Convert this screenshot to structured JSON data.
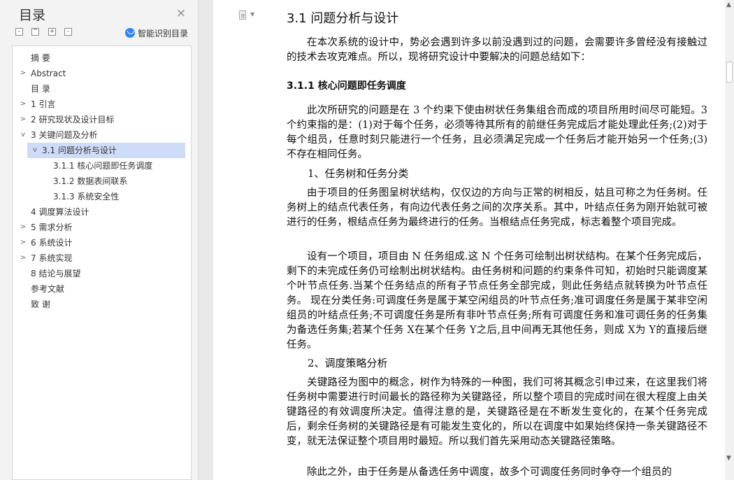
{
  "sidebar": {
    "title": "目录",
    "close_icon": "×",
    "tools": {
      "collapse_all": "-",
      "expand_up": "^",
      "add": "+",
      "remove": "-"
    },
    "smart_toc_label": "智能识别目录",
    "items": [
      {
        "label": "摘  要"
      },
      {
        "label": "Abstract",
        "arrow": ">"
      },
      {
        "label": "目  录"
      },
      {
        "label": "1   引言",
        "arrow": ">"
      },
      {
        "label": "2   研究现状及设计目标",
        "arrow": ">"
      },
      {
        "label": "3   关键问题及分析",
        "arrow": "v"
      },
      {
        "label": "3.1   问题分析与设计",
        "arrow": "v"
      },
      {
        "label": "3.1.1   核心问题即任务调度"
      },
      {
        "label": "3.1.2   数据表间联系"
      },
      {
        "label": "3.1.3   系统安全性"
      },
      {
        "label": "4   调度算法设计"
      },
      {
        "label": "5   需求分析",
        "arrow": ">"
      },
      {
        "label": "6   系统设计",
        "arrow": ">"
      },
      {
        "label": "7   系统实现",
        "arrow": ">"
      },
      {
        "label": "8   结论与展望"
      },
      {
        "label": "参考文献"
      },
      {
        "label": "致   谢"
      }
    ]
  },
  "document": {
    "heading_31": "3.1   问题分析与设计",
    "intro": "在本次系统的设计中，势必会遇到许多以前没遇到过的问题，会需要许多曾经没有接触过的技术去攻克难点。所以，现将研究设计中要解决的问题总结如下：",
    "heading_311": "3.1.1    核心问题即任务调度",
    "p1": "此次所研究的问题是在 3 个约束下使由树状任务集组合而成的项目所用时间尽可能短。3 个约束指的是：(1)对于每个任务，必须等待其所有的前继任务完成后才能处理此任务;(2)对于每个组员，任意时刻只能进行一个任务，且必须满足完成一个任务后才能开始另一个任务;(3)不存在相同任务。",
    "sub1": "1、任务树和任务分类",
    "p2": "由于项目的任务图呈树状结构，仅仅边的方向与正常的树相反，姑且可称之为任务树。任务树上的结点代表任务，有向边代表任务之间的次序关系。其中，叶结点任务为刚开始就可被进行的任务，根结点任务为最终进行的任务。当根结点任务完成，标志着整个项目完成。",
    "p3": "设有一个项目，项目由 N 任务组成.这 N 个任务可绘制出树状结构。在某个任务完成后，剩下的未完成任务仍可绘制出树状结构。由任务树和问题的约束条件可知，初始时只能调度某个叶节点任务.当某个任务结点的所有子节点任务全部完成，则此任务结点就转换为叶节点任务。  现在分类任务:可调度任务是属于某空闲组员的叶节点任务;准可调度任务是属于某非空闲组员的叶结点任务;不可调度任务是所有非叶节点任务;所有可调度任务和准可调任务的任务集为备选任务集;若某个任务 X在某个任务 Y之后,且中间再无其他任务，则成 X为 Y的直接后继任务。",
    "sub2": "2、调度策略分析",
    "p4": "关键路径为图中的概念，树作为特殊的一种图，我们可将其概念引申过来，在这里我们将任务树中需要进行时间最长的路径称为关键路径，所以整个项目的完成时间在很大程度上由关键路径的有效调度所决定。值得注意的是，关键路径是在不断发生变化的，在某个任务完成后，剩余任务树的关键路径是有可能发生变化的，所以在调度中如果始终保持一条关键路径不变，就无法保证整个项目用时最短。所以我们首先采用动态关键路径策略。",
    "p5": "除此之外，由于任务是从备选任务中调度，故多个可调度任务同时争夺一个组员的"
  },
  "scrollbar": {
    "up_icon": "▲",
    "down_icon": "▼"
  }
}
